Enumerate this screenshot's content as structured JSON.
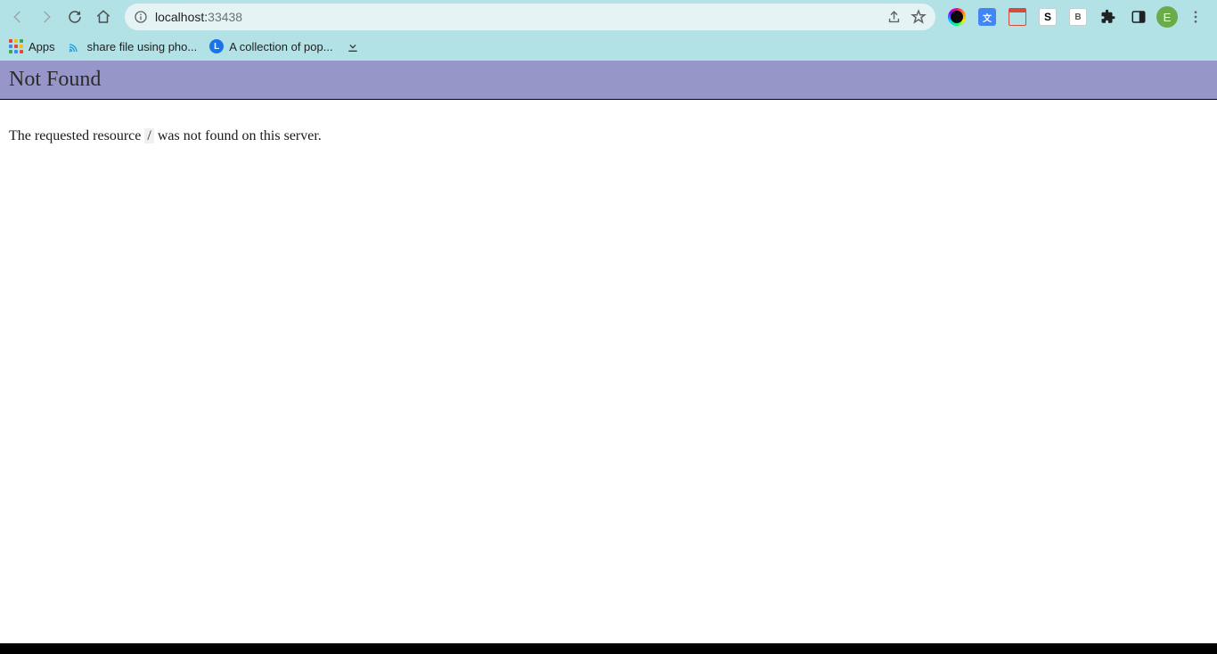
{
  "browser": {
    "address": {
      "host": "localhost:",
      "port": "33438"
    },
    "bookmarks": {
      "apps_label": "Apps",
      "items": [
        {
          "label": "share file using pho..."
        },
        {
          "label": "A collection of pop..."
        }
      ]
    },
    "avatar_initial": "E"
  },
  "page": {
    "title": "Not Found",
    "msg_before": "The requested resource ",
    "msg_path": "/",
    "msg_after": " was not found on this server."
  }
}
